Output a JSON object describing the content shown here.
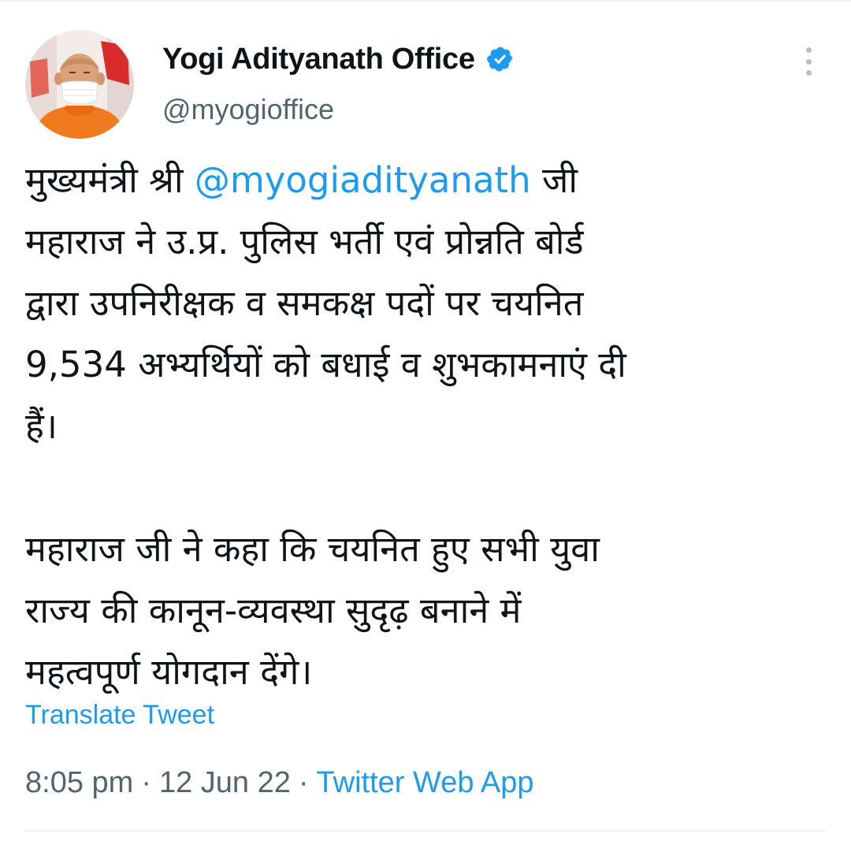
{
  "tweet": {
    "author": {
      "name": "Yogi Adityanath Office",
      "handle": "@myogioffice",
      "verified": true,
      "avatar_icon": "profile-photo"
    },
    "text": {
      "line1_pre": "मुख्यमंत्री श्री ",
      "line1_mention": "@myogiadityanath",
      "line1_post": " जी",
      "line2": "महाराज ने उ.प्र. पुलिस भर्ती एवं प्रोन्नति बोर्ड",
      "line3": "द्वारा उपनिरीक्षक व समकक्ष पदों पर चयनित",
      "line4": "9,534 अभ्यर्थियों को बधाई व शुभकामनाएं दी",
      "line5": "हैं।",
      "line6": "महाराज जी ने कहा कि चयनित हुए सभी युवा",
      "line7": "राज्य की कानून-व्यवस्था सुदृढ़ बनाने में",
      "line8": "महत्वपूर्ण योगदान देंगे।"
    },
    "translate_label": "Translate Tweet",
    "time": "8:05 pm",
    "date": "12 Jun 22",
    "separator": "·",
    "source": "Twitter Web App"
  },
  "colors": {
    "accent": "#1d9bf0",
    "secondary_text": "#536471",
    "primary_text": "#0f1419",
    "divider": "#eff3f4"
  },
  "icons": {
    "verified": "verified-badge-icon",
    "more": "more-options-icon"
  }
}
